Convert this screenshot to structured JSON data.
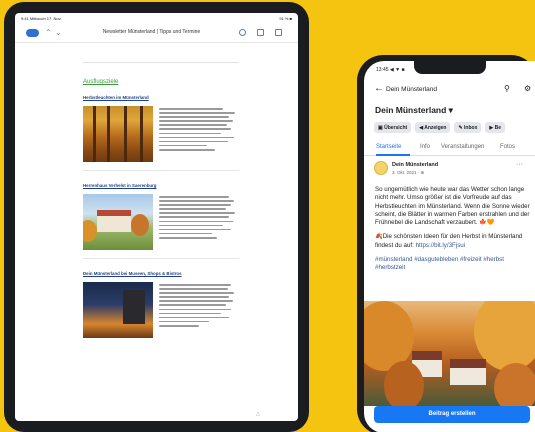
{
  "tablet": {
    "status_left": "9:41 Mittwoch 17. Nov.",
    "status_right": "91 % ■",
    "window_title": "Newsletter Münsterland | Tipps und Termine",
    "section_heading": "Ausflugsziele",
    "articles": [
      {
        "title": "Herbstleuchten im Münsterland"
      },
      {
        "title": "Herrenhaus Verhelst in Saerenburg"
      },
      {
        "title": "Dein Münsterland bei Museen, Shops & Bistros"
      }
    ],
    "home_indicator": "△"
  },
  "phone": {
    "status_time": "13:45 ◀ ▼ ■",
    "nav_title": "Dein Münsterland",
    "page_name": "Dein Münsterland ▾",
    "chips": [
      "▣ Übersicht",
      "◀ Anzeigen",
      "✎ Inbox",
      "▶ Be"
    ],
    "tabs": [
      "Startseite",
      "Info",
      "Veranstaltungen",
      "Fotos"
    ],
    "post": {
      "author": "Dein Münsterland",
      "date": "3. Okt. 2021 · ⊕",
      "paragraph_1": "So ungemütlich wie heute war das Wetter schon lange nicht mehr. Umso größer ist die Vorfreude auf das Herbstleuchten im Münsterland. Wenn die Sonne wieder scheint, die Blätter in warmen Farben erstrahlen und der Frühnebel die Landschaft verzaubert. 🍁🧡",
      "paragraph_2_prefix": "🍂Die schönsten Ideen für den Herbst in Münsterland findest du auf: ",
      "paragraph_2_link": "https://bit.ly/3Fjsui",
      "hashtags": "#münsterland #dasgutebleben #freizeit #herbst #herbstzeit"
    },
    "cta_label": "Beitrag erstellen"
  },
  "colors": {
    "background": "#f5c410",
    "facebook_blue": "#1877f2",
    "section_green": "#3d9c3a",
    "article_link_blue": "#1f3f8a"
  }
}
